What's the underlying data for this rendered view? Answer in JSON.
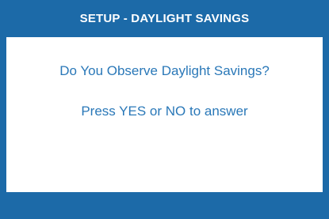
{
  "header": {
    "title": "SETUP - DAYLIGHT SAVINGS"
  },
  "body": {
    "question": "Do You Observe Daylight Savings?",
    "instruction": "Press YES or NO to answer"
  },
  "colors": {
    "accent": "#1c6aa8",
    "text": "#2a78b8",
    "background": "#ffffff"
  }
}
